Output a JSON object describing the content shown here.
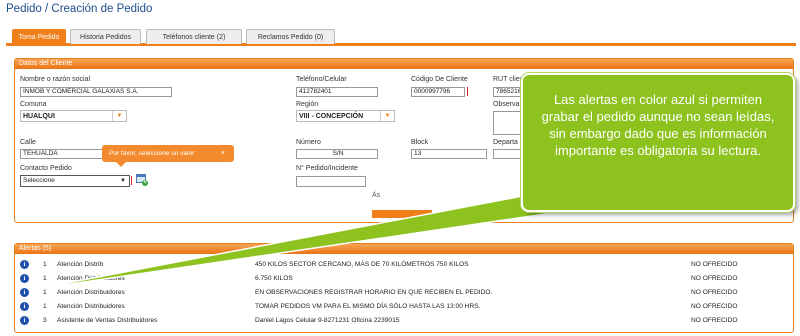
{
  "page": {
    "title": "Pedido / Creación de Pedido"
  },
  "tabs": [
    {
      "label": "Toma Pedido",
      "active": true
    },
    {
      "label": "Historia Pedidos",
      "active": false
    },
    {
      "label": "Teléfonos cliente (2)",
      "active": false
    },
    {
      "label": "Reclamos Pedido (0)",
      "active": false
    }
  ],
  "client_panel": {
    "title": "Datos del Cliente",
    "nombre_label": "Nombre o razón social",
    "nombre_value": "INMOB Y COMERCIAL GALAXIAS S.A.",
    "telefono_label": "Teléfono/Celular",
    "telefono_value": "412782401",
    "codigo_label": "Código De Cliente",
    "codigo_value": "0000997796",
    "rut_label": "RUT cliente",
    "rut_value": "7865216",
    "comuna_label": "Comuna",
    "comuna_value": "HUALQUI",
    "region_label": "Región",
    "region_value": "VIII - CONCEPCIÓN",
    "observ_label": "Observa",
    "calle_label": "Calle",
    "calle_value": "TEHUALDA",
    "numero_label": "Número",
    "numero_value": "S/N",
    "block_label": "Block",
    "block_value": "13",
    "depart_label": "Departa",
    "contacto_label": "Contacto Pedido",
    "contacto_value": "Seleccione",
    "pedido_label": "N° Pedido/Incidente",
    "truncated_text": "Ás"
  },
  "tooltip": {
    "text": "Por favor, seleccione un valor",
    "close": "×"
  },
  "alerts": {
    "title": "Alertas (5)",
    "rows": [
      {
        "num": "1",
        "who": "Atención Distrib",
        "text": "450 KILOS SECTOR CERCANO, MÁS DE 70 KILÓMETROS 750 KILOS",
        "status": "NO OFRECIDO"
      },
      {
        "num": "1",
        "who": "Atención Distribuidores",
        "text": "6.750 KILOS",
        "status": "NO OFRECIDO"
      },
      {
        "num": "1",
        "who": "Atención Distribuidores",
        "text": "EN OBSERVACIONES REGISTRAR HORARIO EN QUE RECIBEN EL PEDIDO.",
        "status": "NO OFRECIDO"
      },
      {
        "num": "1",
        "who": "Atención Distribuidores",
        "text": "TOMAR PEDIDOS VM PARA EL MISMO DÍA SÓLO HASTA LAS 13:00 HRS.",
        "status": "NO OFRECIDO"
      },
      {
        "num": "3",
        "who": "Asistente de Ventas Distribuidores",
        "text": "Daniel Lagos Celular 9-8271231 Oficina 2239015",
        "status": "NO OFRECIDO"
      }
    ]
  },
  "callout": {
    "text": "Las alertas en color azul si permiten grabar el pedido aunque no sean leídas, sin embargo dado que es información importante es obligatoria su lectura."
  },
  "colors": {
    "accent": "#f07f1a",
    "info_blue": "#1f4fa8",
    "callout_green": "#8dc21f",
    "title_blue": "#1f4e8c"
  },
  "icons": {
    "calendar": "calendar-add-icon",
    "info": "info-icon",
    "dropdown": "chevron-down-icon"
  }
}
